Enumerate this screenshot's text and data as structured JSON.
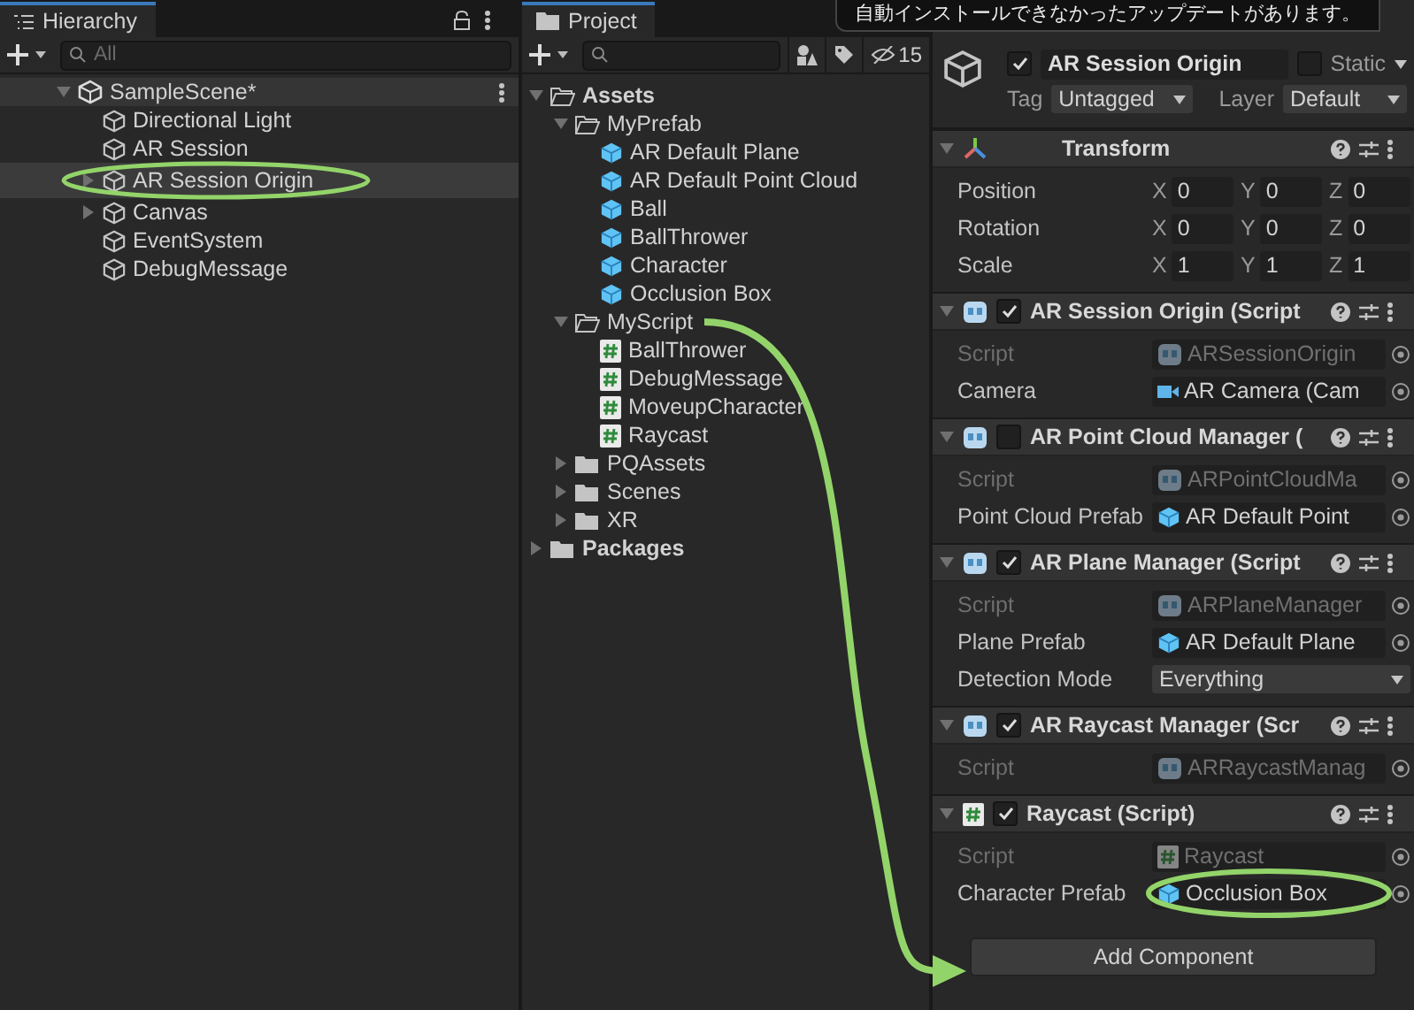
{
  "tooltip": {
    "text": "自動インストールできなかったアップデートがあります。"
  },
  "hierarchy": {
    "tab": "Hierarchy",
    "search": {
      "placeholder": "All"
    },
    "scene": {
      "name": "SampleScene*",
      "expanded": true
    },
    "items": [
      {
        "label": "Directional Light",
        "expandable": false,
        "selected": false
      },
      {
        "label": "AR Session",
        "expandable": false,
        "selected": false
      },
      {
        "label": "AR Session Origin",
        "expandable": true,
        "selected": true,
        "circled": true
      },
      {
        "label": "Canvas",
        "expandable": true,
        "selected": false
      },
      {
        "label": "EventSystem",
        "expandable": false,
        "selected": false
      },
      {
        "label": "DebugMessage",
        "expandable": false,
        "selected": false
      }
    ]
  },
  "project": {
    "tab": "Project",
    "hidden_count": "15",
    "tree": [
      {
        "label": "Assets",
        "kind": "folder",
        "expanded": true,
        "children": [
          {
            "label": "MyPrefab",
            "kind": "folder",
            "expanded": true,
            "children": [
              {
                "label": "AR Default Plane",
                "kind": "prefab"
              },
              {
                "label": "AR Default Point Cloud",
                "kind": "prefab"
              },
              {
                "label": "Ball",
                "kind": "prefab"
              },
              {
                "label": "BallThrower",
                "kind": "prefab"
              },
              {
                "label": "Character",
                "kind": "prefab"
              },
              {
                "label": "Occlusion Box",
                "kind": "prefab"
              }
            ]
          },
          {
            "label": "MyScript",
            "kind": "folder",
            "expanded": true,
            "children": [
              {
                "label": "BallThrower",
                "kind": "script"
              },
              {
                "label": "DebugMessage",
                "kind": "script"
              },
              {
                "label": "MoveupCharacter",
                "kind": "script"
              },
              {
                "label": "Raycast",
                "kind": "script"
              }
            ]
          },
          {
            "label": "PQAssets",
            "kind": "folder",
            "expanded": false
          },
          {
            "label": "Scenes",
            "kind": "folder",
            "expanded": false
          },
          {
            "label": "XR",
            "kind": "folder",
            "expanded": false
          }
        ]
      },
      {
        "label": "Packages",
        "kind": "folder",
        "expanded": false
      }
    ]
  },
  "inspector": {
    "object": {
      "name": "AR Session Origin",
      "active": true,
      "static": false,
      "static_label": "Static",
      "tag_label": "Tag",
      "tag": "Untagged",
      "layer_label": "Layer",
      "layer": "Default"
    },
    "components": [
      {
        "kind": "transform",
        "title": "Transform",
        "fields": [
          {
            "kind": "vector",
            "label": "Position",
            "values": [
              {
                "axis": "X",
                "value": "0"
              },
              {
                "axis": "Y",
                "value": "0"
              },
              {
                "axis": "Z",
                "value": "0"
              }
            ]
          },
          {
            "kind": "vector",
            "label": "Rotation",
            "values": [
              {
                "axis": "X",
                "value": "0"
              },
              {
                "axis": "Y",
                "value": "0"
              },
              {
                "axis": "Z",
                "value": "0"
              }
            ]
          },
          {
            "kind": "vector",
            "label": "Scale",
            "values": [
              {
                "axis": "X",
                "value": "1"
              },
              {
                "axis": "Y",
                "value": "1"
              },
              {
                "axis": "Z",
                "value": "1"
              }
            ]
          }
        ]
      },
      {
        "kind": "ar",
        "title": "AR Session Origin (Script",
        "enabled": true,
        "fields": [
          {
            "kind": "script",
            "label": "Script",
            "value": "ARSessionOrigin"
          },
          {
            "kind": "camera_ref",
            "label": "Camera",
            "value": "AR Camera (Cam"
          }
        ]
      },
      {
        "kind": "ar",
        "title": "AR Point Cloud Manager (",
        "enabled": false,
        "fields": [
          {
            "kind": "script",
            "label": "Script",
            "value": "ARPointCloudMa"
          },
          {
            "kind": "prefab_ref",
            "label": "Point Cloud Prefab",
            "value": "AR Default Point"
          }
        ]
      },
      {
        "kind": "ar",
        "title": "AR Plane Manager (Script",
        "enabled": true,
        "fields": [
          {
            "kind": "script",
            "label": "Script",
            "value": "ARPlaneManager"
          },
          {
            "kind": "prefab_ref",
            "label": "Plane Prefab",
            "value": "AR Default Plane"
          },
          {
            "kind": "dropdown",
            "label": "Detection Mode",
            "value": "Everything"
          }
        ]
      },
      {
        "kind": "ar",
        "title": "AR Raycast Manager (Scr",
        "enabled": true,
        "fields": [
          {
            "kind": "script",
            "label": "Script",
            "value": "ARRaycastManag"
          }
        ]
      },
      {
        "kind": "script",
        "title": "Raycast (Script)",
        "enabled": true,
        "fields": [
          {
            "kind": "script",
            "label": "Script",
            "value": "Raycast"
          },
          {
            "kind": "prefab_ref",
            "label": "Character Prefab",
            "value": "Occlusion Box",
            "circled": true
          }
        ]
      }
    ],
    "add_component": "Add Component"
  }
}
